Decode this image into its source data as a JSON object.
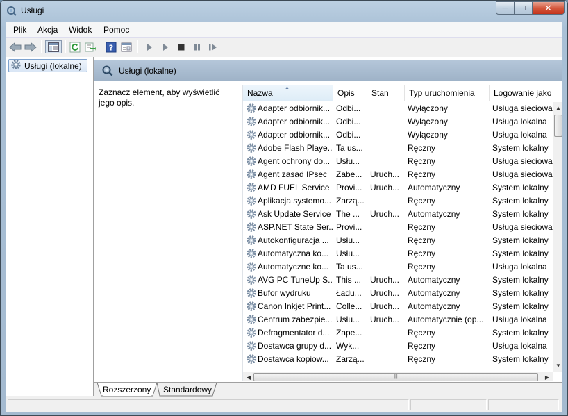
{
  "window": {
    "title": "Usługi",
    "controls": {
      "minimize": "─",
      "maximize": "□",
      "close": "✕"
    }
  },
  "menu": [
    "Plik",
    "Akcja",
    "Widok",
    "Pomoc"
  ],
  "toolbar_icons": [
    "back-icon",
    "forward-icon",
    "show-hide-tree-icon",
    "refresh-icon",
    "export-list-icon",
    "help-icon",
    "properties-icon",
    "start-service-icon",
    "start-service-alt-icon",
    "stop-service-icon",
    "pause-service-icon",
    "restart-service-icon"
  ],
  "tree": {
    "root_label": "Usługi (lokalne)"
  },
  "pane": {
    "header": "Usługi (lokalne)",
    "description": "Zaznacz element, aby wyświetlić jego opis."
  },
  "list": {
    "columns": [
      "Nazwa",
      "Opis",
      "Stan",
      "Typ uruchomienia",
      "Logowanie jako"
    ],
    "sorted_column": "Nazwa",
    "rows": [
      {
        "name": "Adapter odbiornik...",
        "desc": "Odbi...",
        "status": "",
        "startup": "Wyłączony",
        "logon": "Usługa sieciowa"
      },
      {
        "name": "Adapter odbiornik...",
        "desc": "Odbi...",
        "status": "",
        "startup": "Wyłączony",
        "logon": "Usługa lokalna"
      },
      {
        "name": "Adapter odbiornik...",
        "desc": "Odbi...",
        "status": "",
        "startup": "Wyłączony",
        "logon": "Usługa lokalna"
      },
      {
        "name": "Adobe Flash Playe...",
        "desc": "Ta us...",
        "status": "",
        "startup": "Ręczny",
        "logon": "System lokalny"
      },
      {
        "name": "Agent ochrony do...",
        "desc": "Usłu...",
        "status": "",
        "startup": "Ręczny",
        "logon": "Usługa sieciowa"
      },
      {
        "name": "Agent zasad IPsec",
        "desc": "Zabe...",
        "status": "Uruch...",
        "startup": "Ręczny",
        "logon": "Usługa sieciowa"
      },
      {
        "name": "AMD FUEL Service",
        "desc": "Provi...",
        "status": "Uruch...",
        "startup": "Automatyczny",
        "logon": "System lokalny"
      },
      {
        "name": "Aplikacja systemo...",
        "desc": "Zarzą...",
        "status": "",
        "startup": "Ręczny",
        "logon": "System lokalny"
      },
      {
        "name": "Ask Update Service",
        "desc": "The ...",
        "status": "Uruch...",
        "startup": "Automatyczny",
        "logon": "System lokalny"
      },
      {
        "name": "ASP.NET State Ser...",
        "desc": "Provi...",
        "status": "",
        "startup": "Ręczny",
        "logon": "Usługa sieciowa"
      },
      {
        "name": "Autokonfiguracja ...",
        "desc": "Usłu...",
        "status": "",
        "startup": "Ręczny",
        "logon": "System lokalny"
      },
      {
        "name": "Automatyczna ko...",
        "desc": "Usłu...",
        "status": "",
        "startup": "Ręczny",
        "logon": "System lokalny"
      },
      {
        "name": "Automatyczne ko...",
        "desc": "Ta us...",
        "status": "",
        "startup": "Ręczny",
        "logon": "Usługa lokalna"
      },
      {
        "name": "AVG PC TuneUp S...",
        "desc": "This ...",
        "status": "Uruch...",
        "startup": "Automatyczny",
        "logon": "System lokalny"
      },
      {
        "name": "Bufor wydruku",
        "desc": "Ładu...",
        "status": "Uruch...",
        "startup": "Automatyczny",
        "logon": "System lokalny"
      },
      {
        "name": "Canon Inkjet Print...",
        "desc": "Colle...",
        "status": "Uruch...",
        "startup": "Automatyczny",
        "logon": "System lokalny"
      },
      {
        "name": "Centrum zabezpie...",
        "desc": "Usłu...",
        "status": "Uruch...",
        "startup": "Automatycznie (op...",
        "logon": "Usługa lokalna"
      },
      {
        "name": "Defragmentator d...",
        "desc": "Zape...",
        "status": "",
        "startup": "Ręczny",
        "logon": "System lokalny"
      },
      {
        "name": "Dostawca grupy d...",
        "desc": "Wyk...",
        "status": "",
        "startup": "Ręczny",
        "logon": "Usługa lokalna"
      },
      {
        "name": "Dostawca kopiow...",
        "desc": "Zarzą...",
        "status": "",
        "startup": "Ręczny",
        "logon": "System lokalny"
      }
    ]
  },
  "tabs": [
    "Rozszerzony",
    "Standardowy"
  ],
  "active_tab": "Rozszerzony"
}
